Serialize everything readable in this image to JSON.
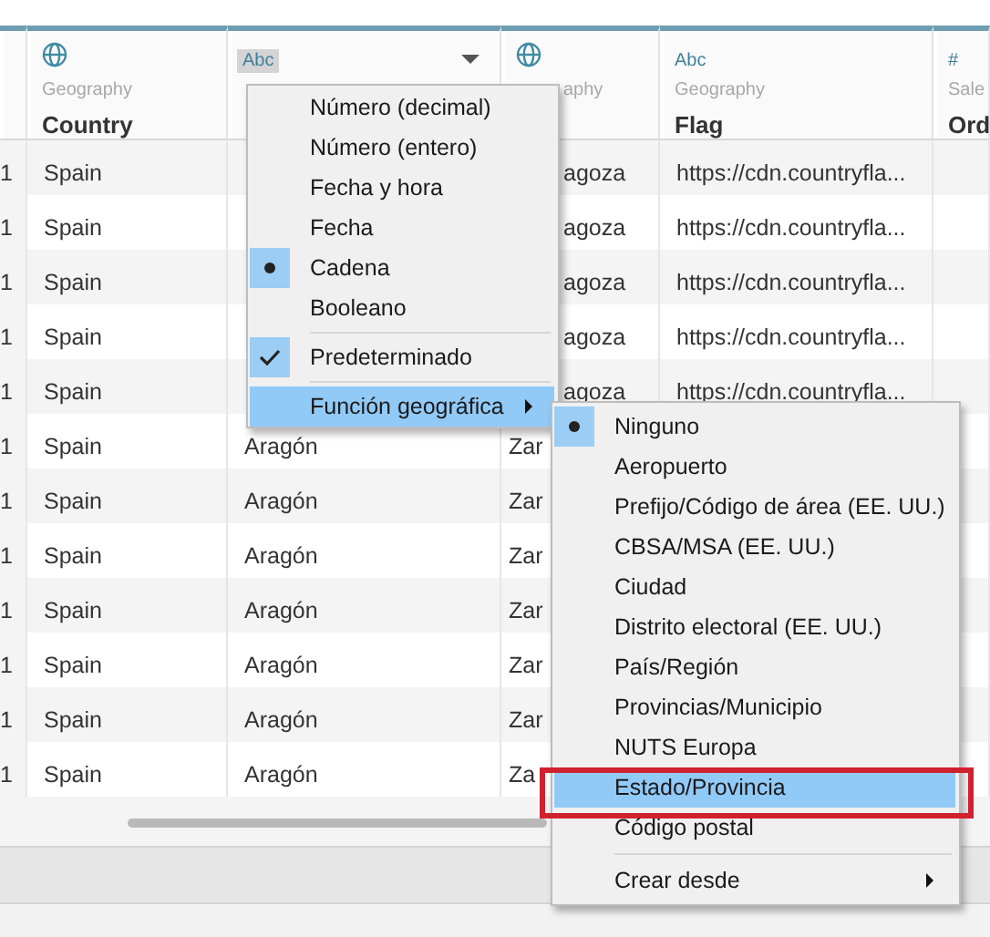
{
  "table": {
    "columns": [
      {
        "kind": "blank"
      },
      {
        "kind": "field",
        "role": "Geography",
        "name": "Country"
      },
      {
        "kind": "field",
        "badge": "Abc",
        "badge_selected": true,
        "dropdown": true
      },
      {
        "kind": "field",
        "role": "aphy"
      },
      {
        "kind": "field",
        "badge": "Abc",
        "badge_selected": false,
        "role": "Geography",
        "name": "Flag"
      },
      {
        "kind": "field",
        "badge": "#",
        "badge_selected": false,
        "role": "Sale",
        "name": "Ord"
      }
    ],
    "rows": [
      {
        "column_1": "1",
        "country": "Spain",
        "column_4": "agoza",
        "flag": "https://cdn.countryfla..."
      },
      {
        "column_1": "1",
        "country": "Spain",
        "column_4": "agoza",
        "flag": "https://cdn.countryfla..."
      },
      {
        "column_1": "1",
        "country": "Spain",
        "column_4": "agoza",
        "flag": "https://cdn.countryfla..."
      },
      {
        "column_1": "1",
        "country": "Spain",
        "column_4": "agoza",
        "flag": "https://cdn.countryfla..."
      },
      {
        "column_1": "1",
        "country": "Spain",
        "column_4": "agoza",
        "flag": "https://cdn.countryfla..."
      },
      {
        "column_1": "1",
        "country": "Spain",
        "column_3": "Aragón",
        "column_4": "Zar"
      },
      {
        "column_1": "1",
        "country": "Spain",
        "column_3": "Aragón",
        "column_4": "Zar"
      },
      {
        "column_1": "1",
        "country": "Spain",
        "column_3": "Aragón",
        "column_4": "Zar"
      },
      {
        "column_1": "1",
        "country": "Spain",
        "column_3": "Aragón",
        "column_4": "Zar"
      },
      {
        "column_1": "1",
        "country": "Spain",
        "column_3": "Aragón",
        "column_4": "Zar"
      },
      {
        "column_1": "1",
        "country": "Spain",
        "column_3": "Aragón",
        "column_4": "Zar"
      },
      {
        "column_1": "1",
        "country": "Spain",
        "column_3": "Aragón",
        "column_4": "Za"
      }
    ]
  },
  "menus": [
    {
      "items": [
        {
          "kind": "radio",
          "label": "Número (decimal)",
          "selected": false,
          "highlighted": false
        },
        {
          "kind": "radio",
          "label": "Número (entero)",
          "selected": false,
          "highlighted": false
        },
        {
          "kind": "radio",
          "label": "Fecha y hora",
          "selected": false,
          "highlighted": false
        },
        {
          "kind": "radio",
          "label": "Fecha",
          "selected": false,
          "highlighted": false
        },
        {
          "kind": "radio",
          "label": "Cadena",
          "selected": true,
          "highlighted": false
        },
        {
          "kind": "radio",
          "label": "Booleano",
          "selected": false,
          "highlighted": false
        },
        {
          "kind": "separator"
        },
        {
          "kind": "check",
          "label": "Predeterminado",
          "checked": true,
          "highlighted": false
        },
        {
          "kind": "separator"
        },
        {
          "kind": "submenu",
          "label": "Función geográfica",
          "highlighted": true
        }
      ]
    },
    {
      "items": [
        {
          "kind": "radio",
          "label": "Ninguno",
          "selected": true,
          "highlighted": false
        },
        {
          "kind": "radio",
          "label": "Aeropuerto",
          "selected": false,
          "highlighted": false
        },
        {
          "kind": "radio",
          "label": "Prefijo/Código de área (EE. UU.)",
          "selected": false,
          "highlighted": false
        },
        {
          "kind": "radio",
          "label": "CBSA/MSA (EE. UU.)",
          "selected": false,
          "highlighted": false
        },
        {
          "kind": "radio",
          "label": "Ciudad",
          "selected": false,
          "highlighted": false
        },
        {
          "kind": "radio",
          "label": "Distrito electoral (EE. UU.)",
          "selected": false,
          "highlighted": false
        },
        {
          "kind": "radio",
          "label": "País/Región",
          "selected": false,
          "highlighted": false
        },
        {
          "kind": "radio",
          "label": "Provincias/Municipio",
          "selected": false,
          "highlighted": false
        },
        {
          "kind": "radio",
          "label": "NUTS Europa",
          "selected": false,
          "highlighted": false
        },
        {
          "kind": "radio",
          "label": "Estado/Provincia",
          "selected": false,
          "highlighted": true,
          "framed": true
        },
        {
          "kind": "radio",
          "label": "Código postal",
          "selected": false,
          "highlighted": false
        },
        {
          "kind": "separator"
        },
        {
          "kind": "submenu",
          "label": "Crear desde",
          "highlighted": false
        }
      ]
    }
  ]
}
